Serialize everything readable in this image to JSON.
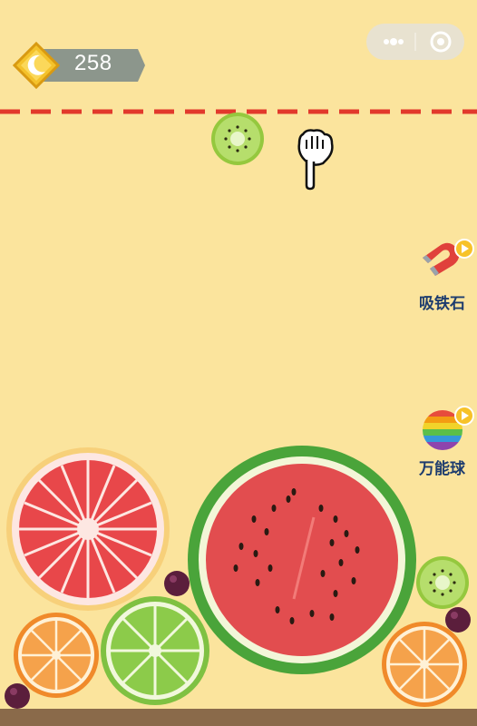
{
  "game": {
    "score": "258",
    "colors": {
      "background": "#fbe49d",
      "dashed_line": "#e2392c",
      "score_banner": "#7f8d8b",
      "tool_label": "#1d3c6e",
      "floor": "#8a6a4a"
    },
    "menu": {
      "more_icon": "three-dots-icon",
      "close_icon": "record-circle-icon"
    },
    "current_fruit": "kiwi",
    "tools": [
      {
        "label": "吸铁石",
        "icon": "magnet-icon"
      },
      {
        "label": "万能球",
        "icon": "rainbow-ball-icon"
      }
    ],
    "board_fruits": [
      "grapefruit",
      "watermelon",
      "orange",
      "lime",
      "kiwi",
      "orange",
      "grape",
      "grape",
      "grape"
    ]
  }
}
